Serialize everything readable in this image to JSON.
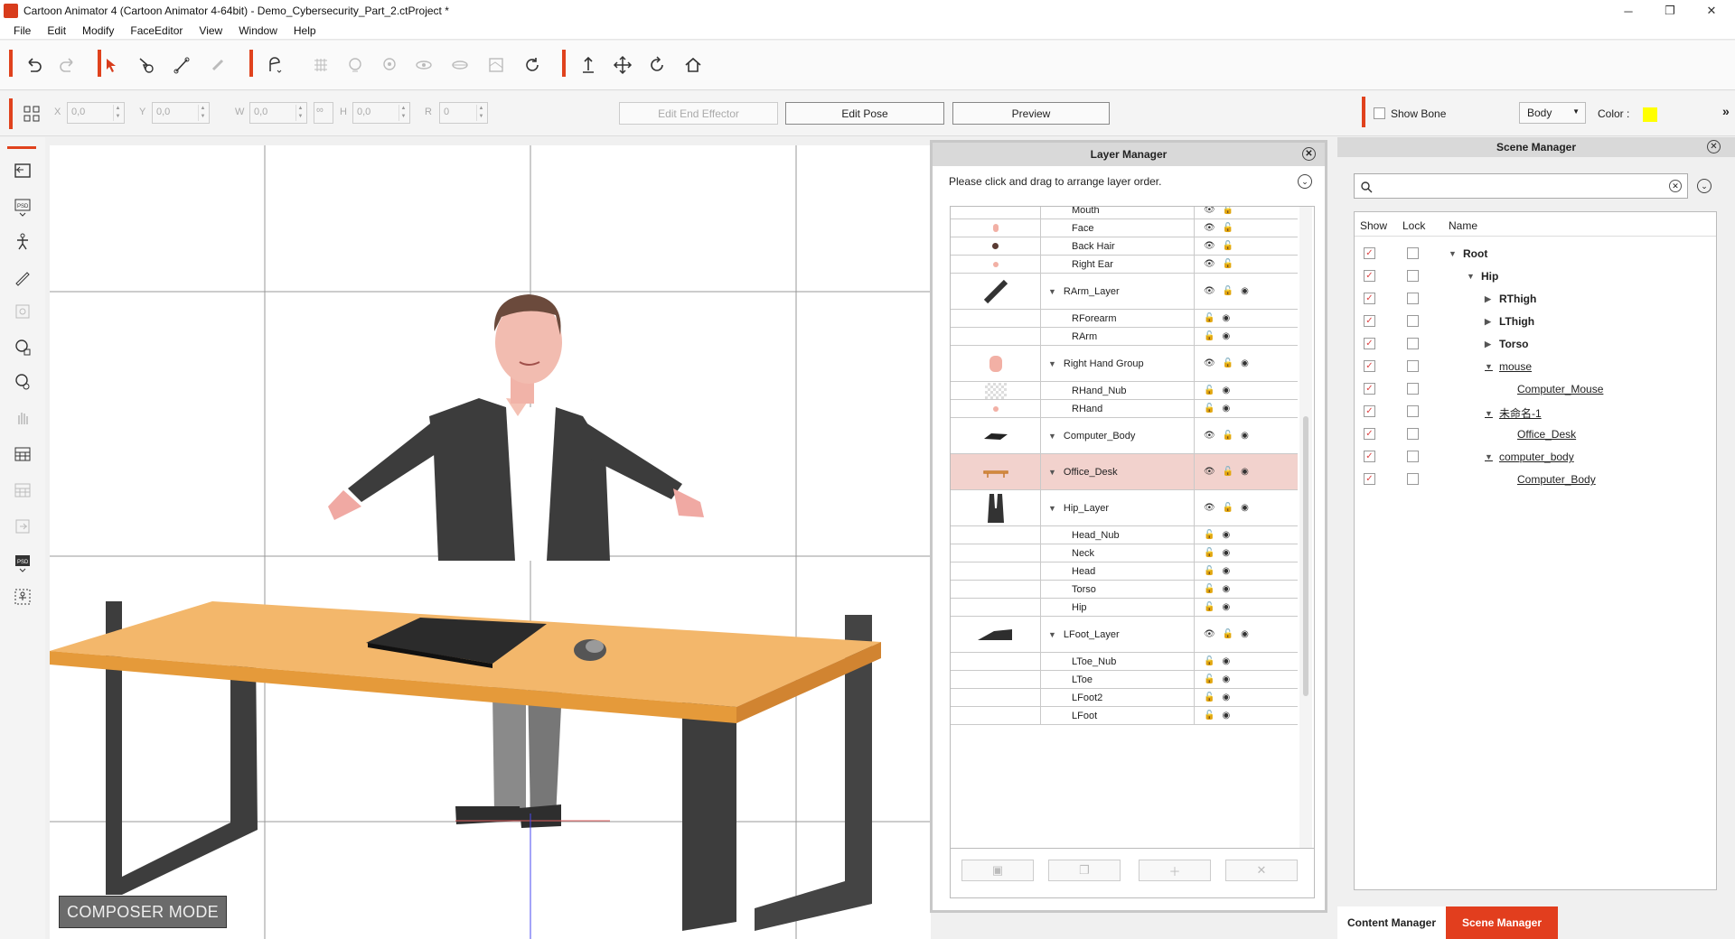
{
  "window": {
    "title": "Cartoon Animator 4  (Cartoon Animator 4-64bit) - Demo_Cybersecurity_Part_2.ctProject *",
    "minimize": "─",
    "restore": "❐",
    "close": "✕"
  },
  "menu": [
    "File",
    "Edit",
    "Modify",
    "FaceEditor",
    "View",
    "Window",
    "Help"
  ],
  "toolbar2": {
    "x_label": "X",
    "x_value": "0,0",
    "y_label": "Y",
    "y_value": "0,0",
    "w_label": "W",
    "w_value": "0,0",
    "h_label": "H",
    "h_value": "0,0",
    "r_label": "R",
    "r_value": "0",
    "edit_end_effector": "Edit End Effector",
    "edit_pose": "Edit Pose",
    "preview": "Preview",
    "show_bone": "Show Bone",
    "body_select": "Body",
    "color_label": "Color :",
    "color_value": "#ffff00",
    "more": "»"
  },
  "canvas": {
    "composer_mode": "COMPOSER MODE"
  },
  "layer_manager": {
    "title": "Layer Manager",
    "hint": "Please click and drag to arrange layer order.",
    "layers": [
      {
        "name": "Mouth",
        "group": false
      },
      {
        "name": "Face",
        "group": false
      },
      {
        "name": "Back Hair",
        "group": false
      },
      {
        "name": "Right Ear",
        "group": false
      },
      {
        "name": "RArm_Layer",
        "group": true
      },
      {
        "name": "RForearm",
        "group": false
      },
      {
        "name": "RArm",
        "group": false
      },
      {
        "name": "Right Hand Group",
        "group": true
      },
      {
        "name": "RHand_Nub",
        "group": false
      },
      {
        "name": "RHand",
        "group": false
      },
      {
        "name": "Computer_Body",
        "group": true
      },
      {
        "name": "Office_Desk",
        "group": true,
        "selected": true
      },
      {
        "name": "Hip_Layer",
        "group": true
      },
      {
        "name": "Head_Nub",
        "group": false
      },
      {
        "name": "Neck",
        "group": false
      },
      {
        "name": "Head",
        "group": false
      },
      {
        "name": "Torso",
        "group": false
      },
      {
        "name": "Hip",
        "group": false
      },
      {
        "name": "LFoot_Layer",
        "group": true
      },
      {
        "name": "LToe_Nub",
        "group": false
      },
      {
        "name": "LToe",
        "group": false
      },
      {
        "name": "LFoot2",
        "group": false
      },
      {
        "name": "LFoot",
        "group": false
      }
    ]
  },
  "scene_manager": {
    "title": "Scene Manager",
    "search_placeholder": "",
    "col_show": "Show",
    "col_lock": "Lock",
    "col_name": "Name",
    "items": [
      {
        "name": "Root",
        "expand": "down",
        "style": "bold",
        "show": true
      },
      {
        "name": "Hip",
        "expand": "down",
        "style": "bold",
        "show": true
      },
      {
        "name": "RThigh",
        "expand": "right",
        "style": "bold",
        "show": true
      },
      {
        "name": "LThigh",
        "expand": "right",
        "style": "bold",
        "show": true
      },
      {
        "name": "Torso",
        "expand": "right",
        "style": "bold",
        "show": true
      },
      {
        "name": "mouse",
        "expand": "down",
        "style": "link",
        "show": true
      },
      {
        "name": "Computer_Mouse",
        "expand": "",
        "style": "link",
        "show": true
      },
      {
        "name": "未命名-1",
        "expand": "down",
        "style": "link",
        "show": true
      },
      {
        "name": "Office_Desk",
        "expand": "",
        "style": "link",
        "show": true
      },
      {
        "name": "computer_body",
        "expand": "down",
        "style": "link",
        "show": true
      },
      {
        "name": "Computer_Body",
        "expand": "",
        "style": "link",
        "show": true
      }
    ],
    "tab_content": "Content Manager",
    "tab_scene": "Scene Manager"
  }
}
